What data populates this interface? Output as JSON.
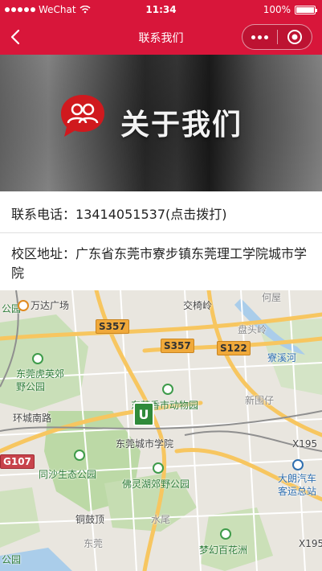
{
  "status_bar": {
    "carrier": "WeChat",
    "time": "11:34",
    "battery": "100%"
  },
  "nav": {
    "title": "联系我们",
    "icons": {
      "back": "chevron-left-icon",
      "more": "more-dots-icon",
      "close": "target-close-icon"
    }
  },
  "banner": {
    "title": "关于我们",
    "logo": "people-chat-icon"
  },
  "contact": {
    "phone_label": "联系电话：",
    "phone_number": "13414051537",
    "phone_action": "(点击拨打)",
    "address_label": "校区地址：",
    "address": "广东省东莞市寮步镇东莞理工学院城市学院"
  },
  "map": {
    "labels": [
      "万达广场",
      "交椅岭",
      "何屋",
      "盘头岭",
      "寮溪河",
      "东莞虎英郊野公园",
      "东莞香市动物园",
      "新围仔",
      "环城南路",
      "东莞城市学院",
      "X195",
      "同沙生态公园",
      "佛灵湖郊野公园",
      "大朗汽车客运总站",
      "铜鼓顶",
      "水尾",
      "梦幻百花洲",
      "X195",
      "公园",
      "公园",
      "东莞"
    ],
    "road_shields": [
      "S357",
      "S357",
      "S122",
      "G107"
    ],
    "marker": "U"
  },
  "colors": {
    "brand_red": "#d8163a",
    "map_green": "#3e9b4a",
    "map_road": "#f7c660"
  }
}
